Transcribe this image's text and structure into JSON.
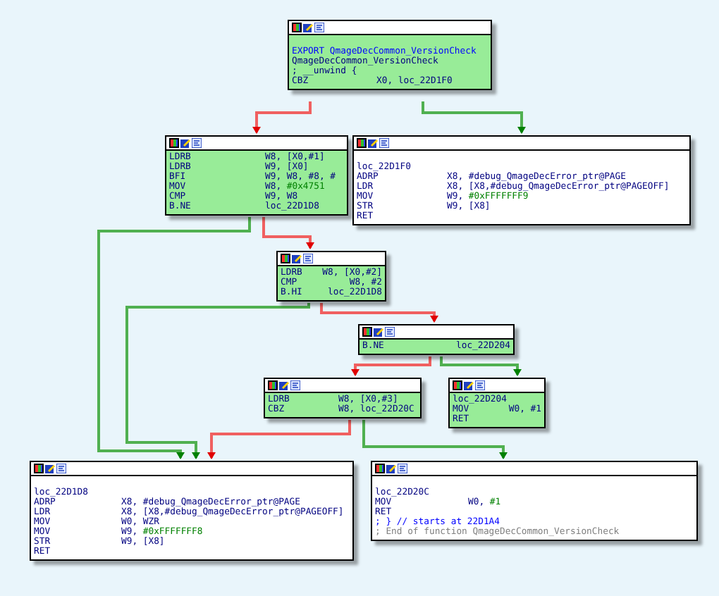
{
  "nodes": [
    {
      "highlighted": true,
      "lines": [
        {
          "kind": "blank"
        },
        {
          "kind": "export",
          "text": "EXPORT QmageDecCommon_VersionCheck"
        },
        {
          "kind": "label",
          "text": "QmageDecCommon_VersionCheck"
        },
        {
          "kind": "directive",
          "text": "; __unwind {"
        },
        {
          "kind": "instr",
          "mnemonic": "CBZ",
          "operands": "X0, loc_22D1F0"
        }
      ]
    },
    {
      "highlighted": true,
      "lines": [
        {
          "kind": "instr",
          "mnemonic": "LDRB",
          "operands": "W8, [X0,#1]"
        },
        {
          "kind": "instr",
          "mnemonic": "LDRB",
          "operands": "W9, [X0]"
        },
        {
          "kind": "instr",
          "mnemonic": "BFI",
          "operands": "W9, W8, #8, #"
        },
        {
          "kind": "instr",
          "mnemonic": "MOV",
          "operands": "W8, ",
          "immediate": "#0x4751"
        },
        {
          "kind": "instr",
          "mnemonic": "CMP",
          "operands": "W9, W8"
        },
        {
          "kind": "instr",
          "mnemonic": "B.NE",
          "operands": "loc_22D1D8"
        }
      ]
    },
    {
      "highlighted": false,
      "lines": [
        {
          "kind": "blank"
        },
        {
          "kind": "label",
          "text": "loc_22D1F0"
        },
        {
          "kind": "instr",
          "mnemonic": "ADRP",
          "operands": "X8, #debug_QmageDecError_ptr@PAGE"
        },
        {
          "kind": "instr",
          "mnemonic": "LDR",
          "operands": "X8, [X8,#debug_QmageDecError_ptr@PAGEOFF]"
        },
        {
          "kind": "instr",
          "mnemonic": "MOV",
          "operands": "W9, ",
          "immediate": "#0xFFFFFFF9"
        },
        {
          "kind": "instr",
          "mnemonic": "STR",
          "operands": "W9, [X8]"
        },
        {
          "kind": "instr",
          "mnemonic": "RET"
        }
      ]
    },
    {
      "highlighted": true,
      "lines": [
        {
          "kind": "instr",
          "mnemonic": "LDRB",
          "operands": "W8, [X0,#2]"
        },
        {
          "kind": "instr",
          "mnemonic": "CMP",
          "operands": "W8, #2"
        },
        {
          "kind": "instr",
          "mnemonic": "B.HI",
          "operands": "loc_22D1D8"
        }
      ]
    },
    {
      "highlighted": true,
      "lines": [
        {
          "kind": "instr",
          "mnemonic": "B.NE",
          "operands": "loc_22D204"
        }
      ]
    },
    {
      "highlighted": true,
      "lines": [
        {
          "kind": "instr",
          "mnemonic": "LDRB",
          "operands": "W8, [X0,#3]"
        },
        {
          "kind": "instr",
          "mnemonic": "CBZ",
          "operands": "W8, loc_22D20C"
        }
      ]
    },
    {
      "highlighted": true,
      "lines": [
        {
          "kind": "label",
          "text": "loc_22D204"
        },
        {
          "kind": "instr",
          "mnemonic": "MOV",
          "operands": "W0, #1"
        },
        {
          "kind": "instr",
          "mnemonic": "RET"
        }
      ]
    },
    {
      "highlighted": false,
      "lines": [
        {
          "kind": "blank"
        },
        {
          "kind": "label",
          "text": "loc_22D1D8"
        },
        {
          "kind": "instr",
          "mnemonic": "ADRP",
          "operands": "X8, #debug_QmageDecError_ptr@PAGE"
        },
        {
          "kind": "instr",
          "mnemonic": "LDR",
          "operands": "X8, [X8,#debug_QmageDecError_ptr@PAGEOFF]"
        },
        {
          "kind": "instr",
          "mnemonic": "MOV",
          "operands": "W0, WZR"
        },
        {
          "kind": "instr",
          "mnemonic": "MOV",
          "operands": "W9, ",
          "immediate": "#0xFFFFFFF8"
        },
        {
          "kind": "instr",
          "mnemonic": "STR",
          "operands": "W9, [X8]"
        },
        {
          "kind": "instr",
          "mnemonic": "RET"
        }
      ]
    },
    {
      "highlighted": false,
      "lines": [
        {
          "kind": "blank"
        },
        {
          "kind": "label",
          "text": "loc_22D20C"
        },
        {
          "kind": "instr",
          "mnemonic": "MOV",
          "operands": "W0, ",
          "immediate": "#1"
        },
        {
          "kind": "instr",
          "mnemonic": "RET"
        },
        {
          "kind": "comment",
          "text": "; } // starts at 22D1A4"
        },
        {
          "kind": "end_comment",
          "text": "; End of function QmageDecCommon_VersionCheck"
        }
      ]
    }
  ]
}
